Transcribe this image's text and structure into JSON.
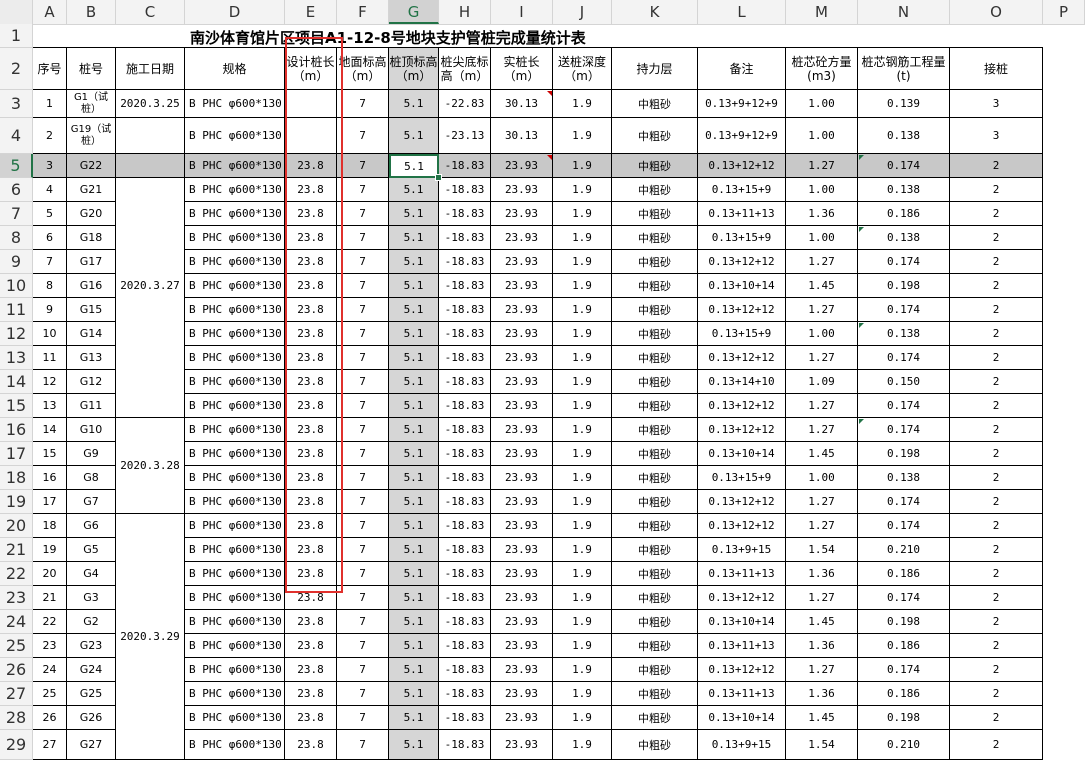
{
  "col_headers": [
    "A",
    "B",
    "C",
    "D",
    "E",
    "F",
    "G",
    "H",
    "I",
    "J",
    "K",
    "L",
    "M",
    "N",
    "O",
    "P"
  ],
  "title": "南沙体育馆片区项目A1-12-8号地块支护管桩完成量统计表",
  "headers": [
    "序号",
    "桩号",
    "施工日期",
    "规格",
    "设计桩长（m）",
    "地面标高（m）",
    "桩顶标高（m）",
    "桩尖底标高（m）",
    "实桩长（m）",
    "送桩深度（m）",
    "持力层",
    "备注",
    "桩芯砼方量(m3)",
    "桩芯钢筋工程量(t)",
    "接桩"
  ],
  "dates": [
    "2020.3.25",
    "2020.3.27",
    "2020.3.28",
    "2020.3.29"
  ],
  "rows": [
    {
      "r": "3",
      "a": "1",
      "b": "G1（试桩）",
      "d": "B PHC φ600*130",
      "e": "",
      "f": "7",
      "g": "5.1",
      "h": "-22.83",
      "i": "30.13",
      "j": "1.9",
      "k": "中粗砂",
      "l": "0.13+9+12+9",
      "m": "1.00",
      "n": "0.139",
      "o": "3"
    },
    {
      "r": "4",
      "a": "2",
      "b": "G19（试桩）",
      "d": "B PHC φ600*130",
      "e": "",
      "f": "7",
      "g": "5.1",
      "h": "-23.13",
      "i": "30.13",
      "j": "1.9",
      "k": "中粗砂",
      "l": "0.13+9+12+9",
      "m": "1.00",
      "n": "0.138",
      "o": "3"
    },
    {
      "r": "5",
      "a": "3",
      "b": "G22",
      "d": "B PHC φ600*130",
      "e": "23.8",
      "f": "7",
      "g": "5.1",
      "h": "-18.83",
      "i": "23.93",
      "j": "1.9",
      "k": "中粗砂",
      "l": "0.13+12+12",
      "m": "1.27",
      "n": "0.174",
      "o": "2"
    },
    {
      "r": "6",
      "a": "4",
      "b": "G21",
      "d": "B PHC φ600*130",
      "e": "23.8",
      "f": "7",
      "g": "5.1",
      "h": "-18.83",
      "i": "23.93",
      "j": "1.9",
      "k": "中粗砂",
      "l": "0.13+15+9",
      "m": "1.00",
      "n": "0.138",
      "o": "2"
    },
    {
      "r": "7",
      "a": "5",
      "b": "G20",
      "d": "B PHC φ600*130",
      "e": "23.8",
      "f": "7",
      "g": "5.1",
      "h": "-18.83",
      "i": "23.93",
      "j": "1.9",
      "k": "中粗砂",
      "l": "0.13+11+13",
      "m": "1.36",
      "n": "0.186",
      "o": "2"
    },
    {
      "r": "8",
      "a": "6",
      "b": "G18",
      "d": "B PHC φ600*130",
      "e": "23.8",
      "f": "7",
      "g": "5.1",
      "h": "-18.83",
      "i": "23.93",
      "j": "1.9",
      "k": "中粗砂",
      "l": "0.13+15+9",
      "m": "1.00",
      "n": "0.138",
      "o": "2"
    },
    {
      "r": "9",
      "a": "7",
      "b": "G17",
      "d": "B PHC φ600*130",
      "e": "23.8",
      "f": "7",
      "g": "5.1",
      "h": "-18.83",
      "i": "23.93",
      "j": "1.9",
      "k": "中粗砂",
      "l": "0.13+12+12",
      "m": "1.27",
      "n": "0.174",
      "o": "2"
    },
    {
      "r": "10",
      "a": "8",
      "b": "G16",
      "d": "B PHC φ600*130",
      "e": "23.8",
      "f": "7",
      "g": "5.1",
      "h": "-18.83",
      "i": "23.93",
      "j": "1.9",
      "k": "中粗砂",
      "l": "0.13+10+14",
      "m": "1.45",
      "n": "0.198",
      "o": "2"
    },
    {
      "r": "11",
      "a": "9",
      "b": "G15",
      "d": "B PHC φ600*130",
      "e": "23.8",
      "f": "7",
      "g": "5.1",
      "h": "-18.83",
      "i": "23.93",
      "j": "1.9",
      "k": "中粗砂",
      "l": "0.13+12+12",
      "m": "1.27",
      "n": "0.174",
      "o": "2"
    },
    {
      "r": "12",
      "a": "10",
      "b": "G14",
      "d": "B PHC φ600*130",
      "e": "23.8",
      "f": "7",
      "g": "5.1",
      "h": "-18.83",
      "i": "23.93",
      "j": "1.9",
      "k": "中粗砂",
      "l": "0.13+15+9",
      "m": "1.00",
      "n": "0.138",
      "o": "2"
    },
    {
      "r": "13",
      "a": "11",
      "b": "G13",
      "d": "B PHC φ600*130",
      "e": "23.8",
      "f": "7",
      "g": "5.1",
      "h": "-18.83",
      "i": "23.93",
      "j": "1.9",
      "k": "中粗砂",
      "l": "0.13+12+12",
      "m": "1.27",
      "n": "0.174",
      "o": "2"
    },
    {
      "r": "14",
      "a": "12",
      "b": "G12",
      "d": "B PHC φ600*130",
      "e": "23.8",
      "f": "7",
      "g": "5.1",
      "h": "-18.83",
      "i": "23.93",
      "j": "1.9",
      "k": "中粗砂",
      "l": "0.13+14+10",
      "m": "1.09",
      "n": "0.150",
      "o": "2"
    },
    {
      "r": "15",
      "a": "13",
      "b": "G11",
      "d": "B PHC φ600*130",
      "e": "23.8",
      "f": "7",
      "g": "5.1",
      "h": "-18.83",
      "i": "23.93",
      "j": "1.9",
      "k": "中粗砂",
      "l": "0.13+12+12",
      "m": "1.27",
      "n": "0.174",
      "o": "2"
    },
    {
      "r": "16",
      "a": "14",
      "b": "G10",
      "d": "B PHC φ600*130",
      "e": "23.8",
      "f": "7",
      "g": "5.1",
      "h": "-18.83",
      "i": "23.93",
      "j": "1.9",
      "k": "中粗砂",
      "l": "0.13+12+12",
      "m": "1.27",
      "n": "0.174",
      "o": "2"
    },
    {
      "r": "17",
      "a": "15",
      "b": "G9",
      "d": "B PHC φ600*130",
      "e": "23.8",
      "f": "7",
      "g": "5.1",
      "h": "-18.83",
      "i": "23.93",
      "j": "1.9",
      "k": "中粗砂",
      "l": "0.13+10+14",
      "m": "1.45",
      "n": "0.198",
      "o": "2"
    },
    {
      "r": "18",
      "a": "16",
      "b": "G8",
      "d": "B PHC φ600*130",
      "e": "23.8",
      "f": "7",
      "g": "5.1",
      "h": "-18.83",
      "i": "23.93",
      "j": "1.9",
      "k": "中粗砂",
      "l": "0.13+15+9",
      "m": "1.00",
      "n": "0.138",
      "o": "2"
    },
    {
      "r": "19",
      "a": "17",
      "b": "G7",
      "d": "B PHC φ600*130",
      "e": "23.8",
      "f": "7",
      "g": "5.1",
      "h": "-18.83",
      "i": "23.93",
      "j": "1.9",
      "k": "中粗砂",
      "l": "0.13+12+12",
      "m": "1.27",
      "n": "0.174",
      "o": "2"
    },
    {
      "r": "20",
      "a": "18",
      "b": "G6",
      "d": "B PHC φ600*130",
      "e": "23.8",
      "f": "7",
      "g": "5.1",
      "h": "-18.83",
      "i": "23.93",
      "j": "1.9",
      "k": "中粗砂",
      "l": "0.13+12+12",
      "m": "1.27",
      "n": "0.174",
      "o": "2"
    },
    {
      "r": "21",
      "a": "19",
      "b": "G5",
      "d": "B PHC φ600*130",
      "e": "23.8",
      "f": "7",
      "g": "5.1",
      "h": "-18.83",
      "i": "23.93",
      "j": "1.9",
      "k": "中粗砂",
      "l": "0.13+9+15",
      "m": "1.54",
      "n": "0.210",
      "o": "2"
    },
    {
      "r": "22",
      "a": "20",
      "b": "G4",
      "d": "B PHC φ600*130",
      "e": "23.8",
      "f": "7",
      "g": "5.1",
      "h": "-18.83",
      "i": "23.93",
      "j": "1.9",
      "k": "中粗砂",
      "l": "0.13+11+13",
      "m": "1.36",
      "n": "0.186",
      "o": "2"
    },
    {
      "r": "23",
      "a": "21",
      "b": "G3",
      "d": "B PHC φ600*130",
      "e": "23.8",
      "f": "7",
      "g": "5.1",
      "h": "-18.83",
      "i": "23.93",
      "j": "1.9",
      "k": "中粗砂",
      "l": "0.13+12+12",
      "m": "1.27",
      "n": "0.174",
      "o": "2"
    },
    {
      "r": "24",
      "a": "22",
      "b": "G2",
      "d": "B PHC φ600*130",
      "e": "23.8",
      "f": "7",
      "g": "5.1",
      "h": "-18.83",
      "i": "23.93",
      "j": "1.9",
      "k": "中粗砂",
      "l": "0.13+10+14",
      "m": "1.45",
      "n": "0.198",
      "o": "2"
    },
    {
      "r": "25",
      "a": "23",
      "b": "G23",
      "d": "B PHC φ600*130",
      "e": "23.8",
      "f": "7",
      "g": "5.1",
      "h": "-18.83",
      "i": "23.93",
      "j": "1.9",
      "k": "中粗砂",
      "l": "0.13+11+13",
      "m": "1.36",
      "n": "0.186",
      "o": "2"
    },
    {
      "r": "26",
      "a": "24",
      "b": "G24",
      "d": "B PHC φ600*130",
      "e": "23.8",
      "f": "7",
      "g": "5.1",
      "h": "-18.83",
      "i": "23.93",
      "j": "1.9",
      "k": "中粗砂",
      "l": "0.13+12+12",
      "m": "1.27",
      "n": "0.174",
      "o": "2"
    },
    {
      "r": "27",
      "a": "25",
      "b": "G25",
      "d": "B PHC φ600*130",
      "e": "23.8",
      "f": "7",
      "g": "5.1",
      "h": "-18.83",
      "i": "23.93",
      "j": "1.9",
      "k": "中粗砂",
      "l": "0.13+11+13",
      "m": "1.36",
      "n": "0.186",
      "o": "2"
    },
    {
      "r": "28",
      "a": "26",
      "b": "G26",
      "d": "B PHC φ600*130",
      "e": "23.8",
      "f": "7",
      "g": "5.1",
      "h": "-18.83",
      "i": "23.93",
      "j": "1.9",
      "k": "中粗砂",
      "l": "0.13+10+14",
      "m": "1.45",
      "n": "0.198",
      "o": "2"
    },
    {
      "r": "29",
      "a": "27",
      "b": "G27",
      "d": "B PHC φ600*130",
      "e": "23.8",
      "f": "7",
      "g": "5.1",
      "h": "-18.83",
      "i": "23.93",
      "j": "1.9",
      "k": "中粗砂",
      "l": "0.13+9+15",
      "m": "1.54",
      "n": "0.210",
      "o": "2"
    }
  ],
  "row_headers": [
    "1",
    "2"
  ],
  "active_cell": "G5",
  "colors": {
    "grid_line": "#000000",
    "header_bg": "#f3f3f3",
    "selected_col": "#d6d6d6",
    "selected_row": "#c8c8c8",
    "accent": "#217346",
    "annotation_box": "#e0302c"
  }
}
